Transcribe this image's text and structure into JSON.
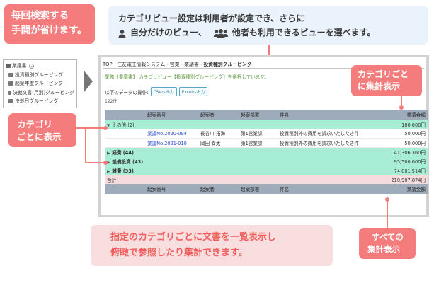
{
  "callouts": {
    "top_left": {
      "line1": "毎回検索する",
      "line2": "手間が省けます。"
    },
    "top_center": {
      "line1": "カテゴリビュー設定は利用者が設定でき、さらに",
      "line2_a": "自分だけのビュー、",
      "line2_b": "他者も利用できるビューを選べます。"
    },
    "category": {
      "line1": "カテゴリ",
      "line2": "ごとに表示"
    },
    "subtotal": {
      "line1": "カテゴリごと",
      "line2": "に集計表示"
    },
    "bottom_center": {
      "line1": "指定のカテゴリごとに文書を一覧表示し",
      "line2": "俯瞰で参照したり集計できます。"
    },
    "grandtotal": {
      "line1": "すべての",
      "line2": "集計表示"
    }
  },
  "tree": {
    "root": "業議書",
    "items": [
      "投資種別グルーピング",
      "起案年度グルーピング",
      "決裁文書(月別)グルーピング",
      "決裁日グルーピング"
    ]
  },
  "screen": {
    "breadcrumb_prefix": "TOP - 住友電工情報システム - 営業 - 業議書 - ",
    "breadcrumb_current": "投資種別グルーピング",
    "notice": "業務【業議書】 カテゴリビュー【投資種別グルーピング】を選択しています。",
    "ops_label": "以下のデータの操作:",
    "csv_btn": "CSVへ出力",
    "excel_btn": "Excelへ出力",
    "count": "122件",
    "columns": [
      "",
      "起案番号",
      "起案者",
      "起案部署",
      "件名",
      "業議金額"
    ],
    "groups": [
      {
        "label": "その他 (2)",
        "total": "100,000円",
        "expanded": true
      },
      {
        "label": "経費 (44)",
        "total": "41,306,360円",
        "expanded": false
      },
      {
        "label": "設備投資 (43)",
        "total": "95,500,000円",
        "expanded": false
      },
      {
        "label": "雑費 (33)",
        "total": "74,001,514円",
        "expanded": false
      }
    ],
    "docs": [
      {
        "no": "業議No.2020-094",
        "author": "長谷川 拓海",
        "dept": "第1営業課",
        "subject": "投資種別外の費用を請求いたしたき件",
        "amount": "50,000円"
      },
      {
        "no": "業議No.2021-010",
        "author": "岡田 奏太",
        "dept": "第1営業課",
        "subject": "投資種別外の費用を請求いたしたき件",
        "amount": "50,000円"
      }
    ],
    "total_label": "合計",
    "total_value": "210,907,874円"
  }
}
